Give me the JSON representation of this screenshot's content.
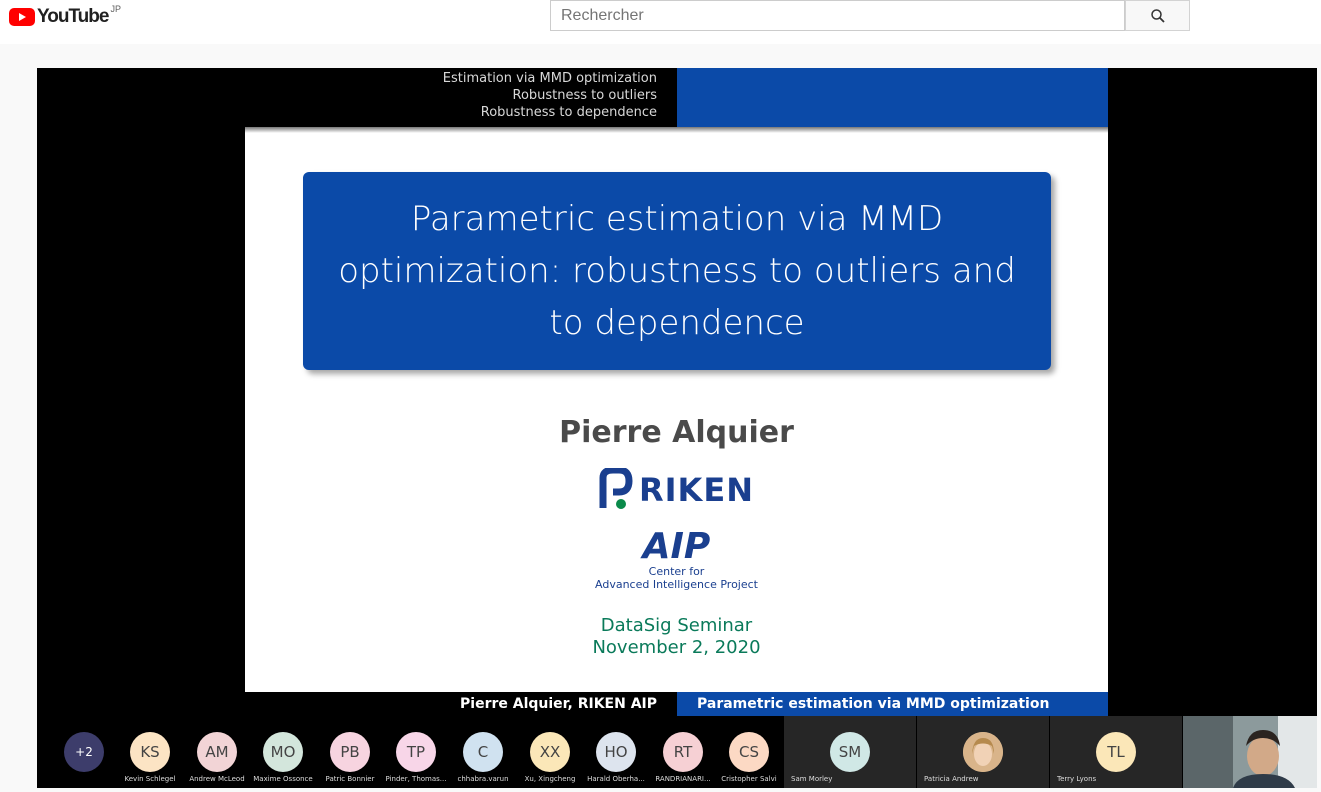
{
  "header": {
    "logo_text": "YouTube",
    "region": "JP",
    "search_placeholder": "Rechercher",
    "search_icon": "search-icon"
  },
  "slide": {
    "nav_items": [
      "Estimation via MMD optimization",
      "Robustness to outliers",
      "Robustness to dependence"
    ],
    "title": "Parametric estimation via MMD optimization: robustness to outliers and to dependence",
    "author": "Pierre Alquier",
    "riken_logo_text": "RIKEN",
    "aip_logo_text": "AIP",
    "aip_subtitle_1": "Center for",
    "aip_subtitle_2": "Advanced Intelligence Project",
    "seminar": "DataSig Seminar",
    "date": "November 2, 2020",
    "footer_left": "Pierre Alquier, RIKEN AIP",
    "footer_right": "Parametric estimation via MMD optimization",
    "colors": {
      "title_bg": "#0b4aa8",
      "seminar_text": "#0a7a5a"
    }
  },
  "participants": {
    "overflow_count": "+2",
    "people": [
      {
        "initials": "KS",
        "name": "Kevin Schlegel",
        "color": "#fce4c4"
      },
      {
        "initials": "AM",
        "name": "Andrew McLeod",
        "color": "#f2d4d6"
      },
      {
        "initials": "MO",
        "name": "Maxime Ossonce",
        "color": "#d3e6dc"
      },
      {
        "initials": "PB",
        "name": "Patric Bonnier",
        "color": "#f7d4e0"
      },
      {
        "initials": "TP",
        "name": "Pinder, Thomas...",
        "color": "#f8d6e8"
      },
      {
        "initials": "C",
        "name": "chhabra.varun",
        "color": "#d0e2f0"
      },
      {
        "initials": "XX",
        "name": "Xu, Xingcheng",
        "color": "#fbe7b8"
      },
      {
        "initials": "HO",
        "name": "Harald Oberha...",
        "color": "#dde4ee"
      },
      {
        "initials": "RT",
        "name": "RANDRIANARI...",
        "color": "#f6d0d4"
      },
      {
        "initials": "CS",
        "name": "Cristopher Salvi",
        "color": "#fcd9c4"
      }
    ],
    "tiles": [
      {
        "initials": "SM",
        "name": "Sam Morley",
        "color": "#d0e8e6"
      },
      {
        "initials": "",
        "name": "Patricia Andrew",
        "color": "#e9c9a5"
      },
      {
        "initials": "TL",
        "name": "Terry Lyons",
        "color": "#fbe7b8"
      }
    ]
  }
}
